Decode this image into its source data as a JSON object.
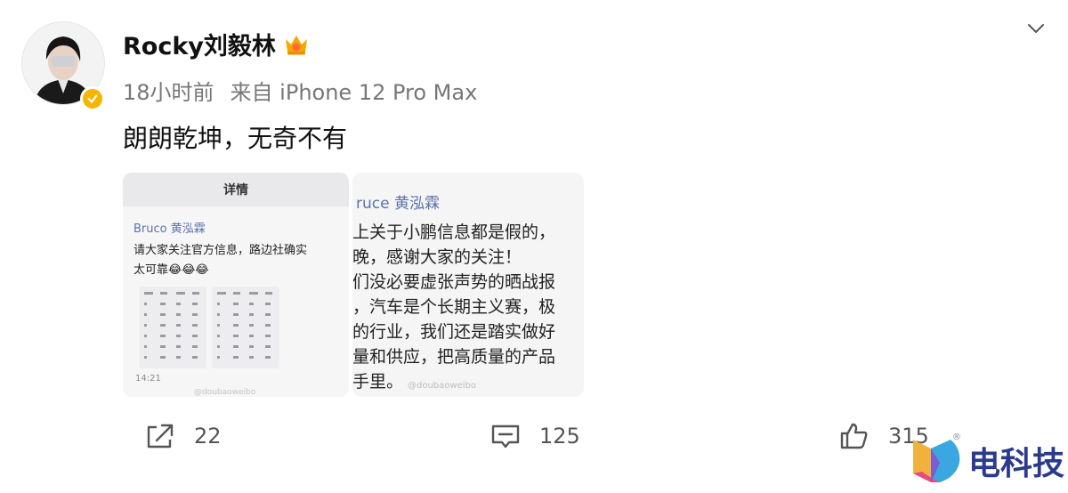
{
  "post": {
    "username": "Rocky刘毅林",
    "time": "18小时前",
    "source": "来自 iPhone 12 Pro Max",
    "text": "朗朗乾坤，无奇不有"
  },
  "image1": {
    "header": "详情",
    "author": "Bruco 黄泓霖",
    "lines": [
      "请大家关注官方信息，路边社确实",
      "太可靠😂😂😂"
    ],
    "time": "14:21",
    "watermark": "@doubaoweibo"
  },
  "image2": {
    "author": "ruce 黄泓霖",
    "lines": [
      "上关于小鹏信息都是假的，",
      "晚，感谢大家的关注！",
      "们没必要虚张声势的晒战报",
      "，汽车是个长期主义赛，极",
      "的行业，我们还是踏实做好",
      "量和供应，把高质量的产品",
      "手里。"
    ],
    "watermark": "@doubaoweibo"
  },
  "actions": {
    "shares": "22",
    "comments": "125",
    "likes": "315"
  },
  "brand": {
    "text": "电科技",
    "reg_mark": "®"
  },
  "colors": {
    "verified_badge": "#f7b500",
    "author_link": "#5a73a8",
    "brand": "#2b3a8c"
  },
  "icons": {
    "header_menu": "chevron-down-icon",
    "share": "share-icon",
    "comment": "comment-icon",
    "like": "thumbs-up-icon"
  }
}
